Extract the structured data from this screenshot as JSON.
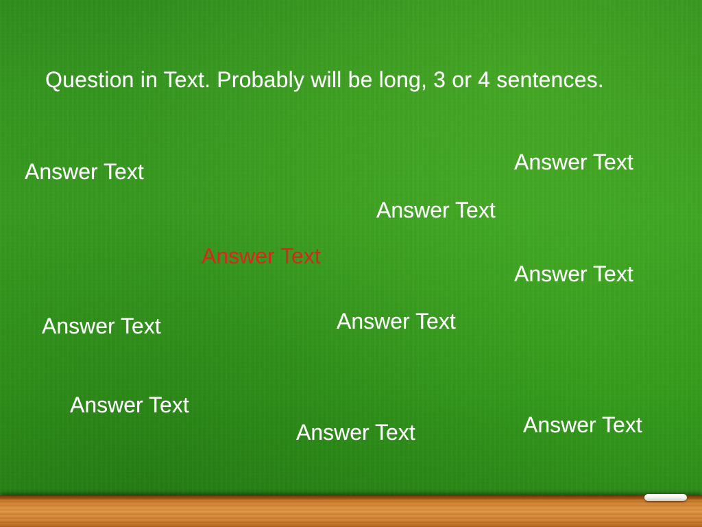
{
  "question": {
    "text": "Question in Text.  Probably will be long, 3 or 4 sentences."
  },
  "answers": [
    {
      "text": "Answer Text",
      "color": "#ffffff"
    },
    {
      "text": "Answer Text",
      "color": "#ffffff"
    },
    {
      "text": "Answer Text",
      "color": "#ffffff"
    },
    {
      "text": "Answer Text",
      "color": "#d8281c"
    },
    {
      "text": "Answer Text",
      "color": "#ffffff"
    },
    {
      "text": "Answer Text",
      "color": "#ffffff"
    },
    {
      "text": "Answer Text",
      "color": "#ffffff"
    },
    {
      "text": "Answer Text",
      "color": "#ffffff"
    },
    {
      "text": "Answer Text",
      "color": "#ffffff"
    },
    {
      "text": "Answer Text",
      "color": "#ffffff"
    }
  ],
  "colors": {
    "board": "#339a1b",
    "tray": "#d48638",
    "chalk": "#f1f1ec",
    "highlight_answer": "#d8281c"
  }
}
